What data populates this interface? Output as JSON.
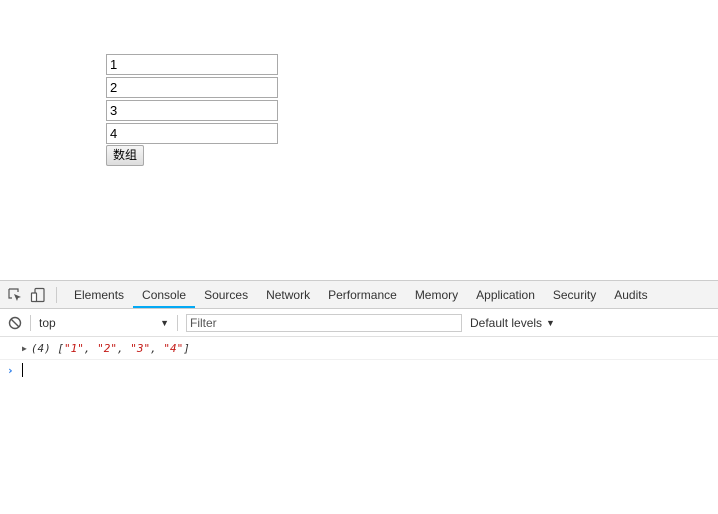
{
  "form": {
    "inputs": [
      "1",
      "2",
      "3",
      "4"
    ],
    "button_label": "数组"
  },
  "devtools": {
    "tabs": [
      "Elements",
      "Console",
      "Sources",
      "Network",
      "Performance",
      "Memory",
      "Application",
      "Security",
      "Audits"
    ],
    "active_tab": "Console",
    "context": "top",
    "filter_placeholder": "Filter",
    "levels_label": "Default levels",
    "log": {
      "count": "(4)",
      "open_bracket": "[",
      "items": [
        "\"1\"",
        "\"2\"",
        "\"3\"",
        "\"4\""
      ],
      "close_bracket": "]"
    },
    "icons": {
      "inspect": "inspect-element-icon",
      "device": "device-toolbar-icon",
      "clear": "clear-console-icon",
      "prompt": "console-prompt-icon"
    },
    "colors": {
      "active_tab_underline": "#03a9f4",
      "string_value": "#c41a16",
      "prompt": "#1a73e8"
    }
  }
}
